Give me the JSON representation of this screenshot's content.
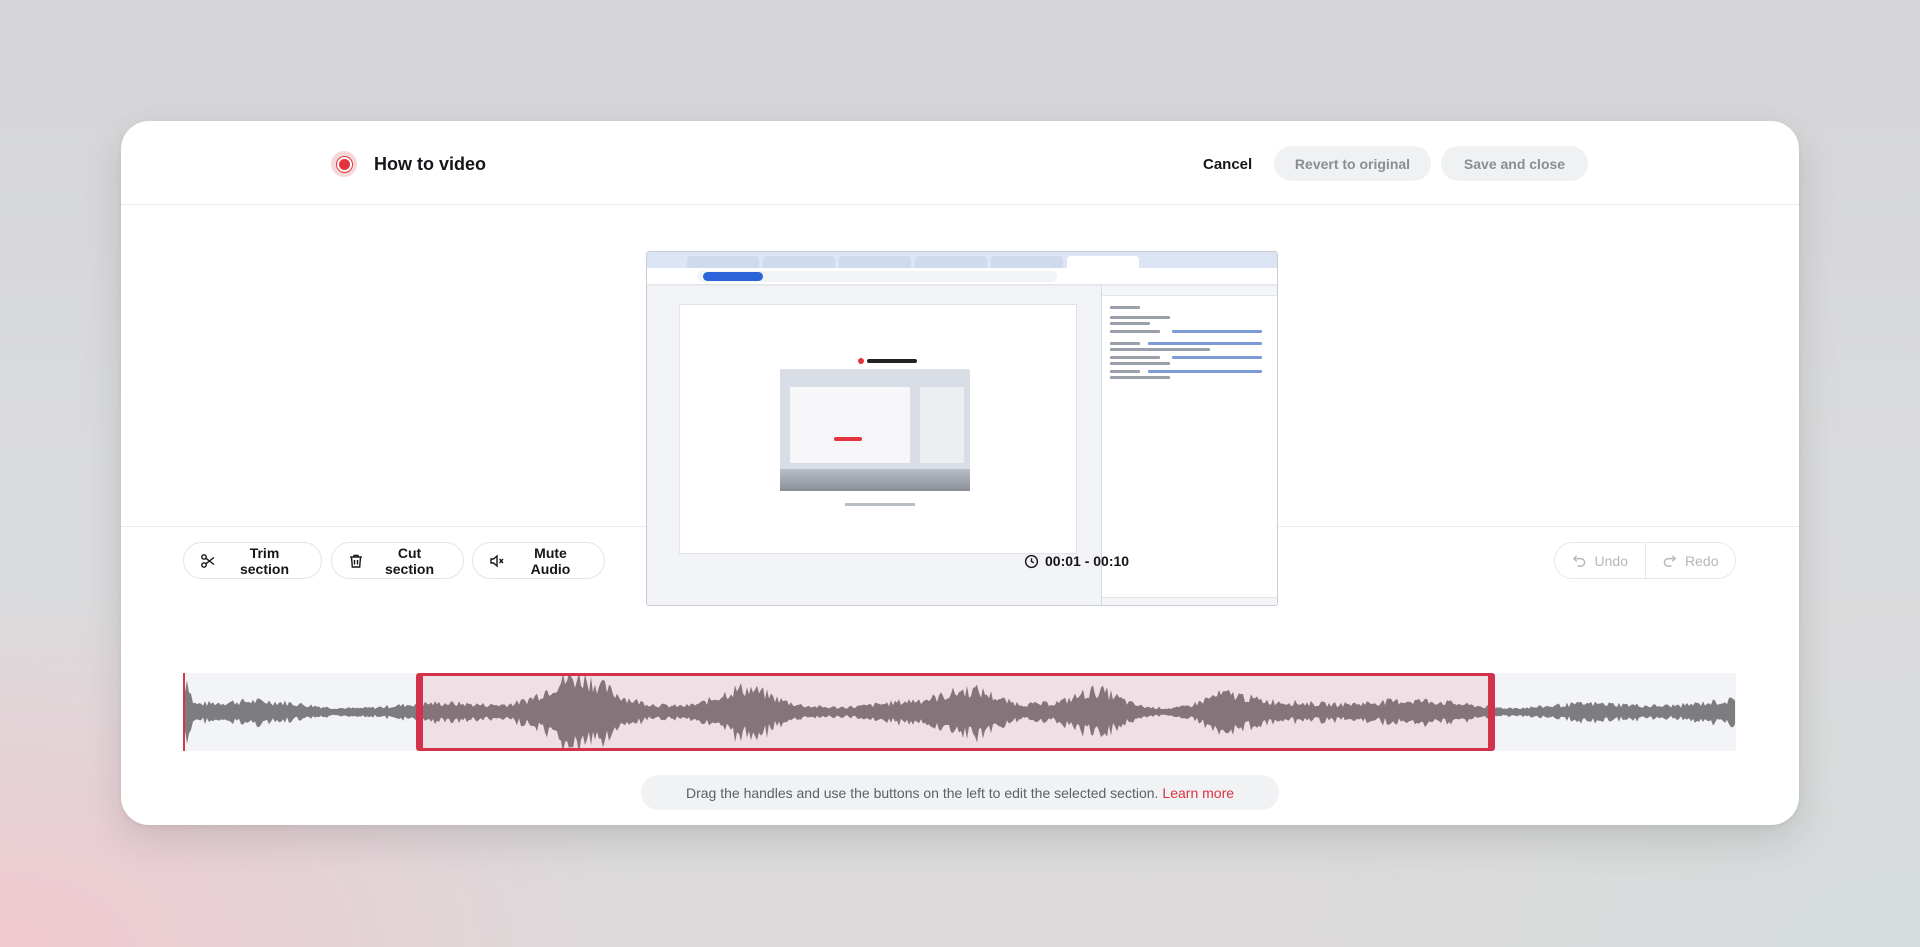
{
  "header": {
    "title": "How to video",
    "cancel_label": "Cancel",
    "revert_label": "Revert to original",
    "save_label": "Save and close"
  },
  "toolbar": {
    "trim_label": "Trim section",
    "cut_label": "Cut section",
    "mute_label": "Mute Audio",
    "time_range": "00:01 - 00:10",
    "undo_label": "Undo",
    "redo_label": "Redo"
  },
  "hint": {
    "text": "Drag the handles and use the buttons on the left to edit the selected section.",
    "link_label": "Learn more"
  },
  "colors": {
    "accent": "#d2334a",
    "brand_red": "#e3333d",
    "waveform": "#7d7d7f"
  }
}
